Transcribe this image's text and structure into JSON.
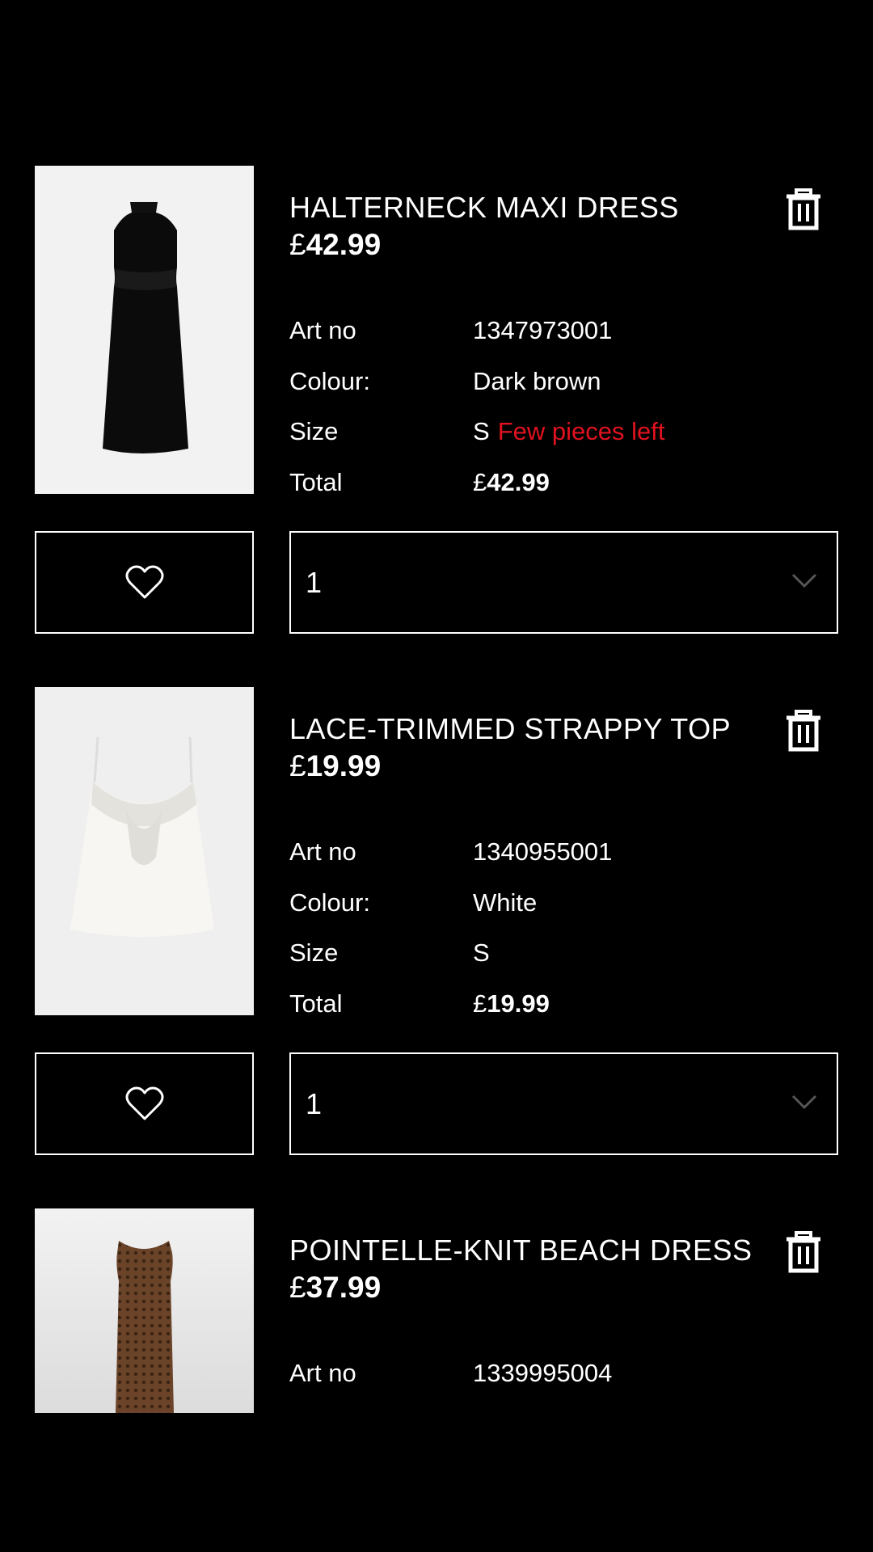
{
  "colors": {
    "background": "#000000",
    "text": "#ffffff",
    "warning": "#e0121f"
  },
  "labels": {
    "art_no": "Art no",
    "colour": "Colour:",
    "size": "Size",
    "total": "Total",
    "currency": "£"
  },
  "items": [
    {
      "title": "HALTERNECK MAXI DRESS",
      "price": "42.99",
      "art_no": "1347973001",
      "colour": "Dark brown",
      "size": "S",
      "stock_warning": "Few pieces left",
      "total": "42.99",
      "quantity": "1",
      "image_icon": "halterneck-dress-photo"
    },
    {
      "title": "LACE-TRIMMED STRAPPY TOP",
      "price": "19.99",
      "art_no": "1340955001",
      "colour": "White",
      "size": "S",
      "total": "19.99",
      "quantity": "1",
      "image_icon": "strappy-top-photo"
    },
    {
      "title": "POINTELLE-KNIT BEACH DRESS",
      "price": "37.99",
      "art_no": "1339995004",
      "image_icon": "beach-dress-photo"
    }
  ]
}
